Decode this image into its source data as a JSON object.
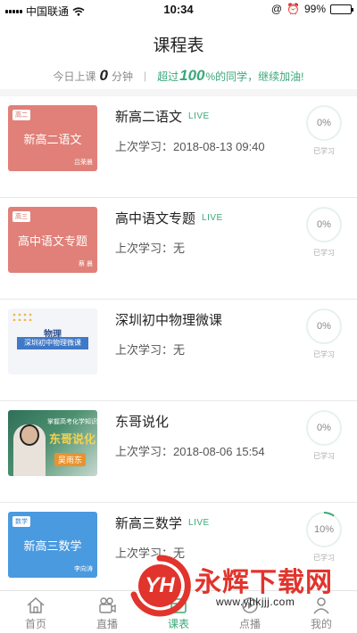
{
  "status_bar": {
    "carrier": "中国联通",
    "time": "10:34",
    "battery_text": "99%",
    "battery_level": 0.99
  },
  "header": {
    "title": "课程表"
  },
  "summary": {
    "prefix": "今日上课",
    "minutes": "0",
    "minutes_unit": "分钟",
    "separator": "|",
    "exceed_prefix": "超过",
    "exceed_percent": "100",
    "exceed_suffix": "%的同学，继续加油!"
  },
  "courses": [
    {
      "title": "新高二语文",
      "live": "LIVE",
      "last_study": "上次学习：2018-08-13  09:40",
      "progress_text": "0%",
      "progress": 0,
      "progress_label": "已学习",
      "thumb_tag": "高二",
      "thumb_title": "新高二语文",
      "thumb_teacher": "吕荣晨"
    },
    {
      "title": "高中语文专题",
      "live": "LIVE",
      "last_study": "上次学习：无",
      "progress_text": "0%",
      "progress": 0,
      "progress_label": "已学习",
      "thumb_tag": "高三",
      "thumb_title": "高中语文专题",
      "thumb_teacher": "蔡  晨"
    },
    {
      "title": "深圳初中物理微课",
      "live": "",
      "last_study": "上次学习：无",
      "progress_text": "0%",
      "progress": 0,
      "progress_label": "已学习",
      "thumb_label": "物理",
      "thumb_bar": "深圳初中物理微课"
    },
    {
      "title": "东哥说化",
      "live": "",
      "last_study": "上次学习：2018-08-06  15:54",
      "progress_text": "0%",
      "progress": 0,
      "progress_label": "已学习",
      "thumb_line": "掌握高考化学知识",
      "thumb_title": "东哥说化",
      "thumb_name": "吴雨东"
    },
    {
      "title": "新高三数学",
      "live": "LIVE",
      "last_study": "上次学习：无",
      "progress_text": "10%",
      "progress": 0.1,
      "progress_label": "已学习",
      "thumb_tag": "数学",
      "thumb_title": "新高三数学",
      "thumb_teacher": "李向涛"
    }
  ],
  "tabs": [
    {
      "label": "首页",
      "icon": "home-icon",
      "active": false
    },
    {
      "label": "直播",
      "icon": "camera-icon",
      "active": false
    },
    {
      "label": "课表",
      "icon": "schedule-icon",
      "active": true
    },
    {
      "label": "点播",
      "icon": "play-icon",
      "active": false
    },
    {
      "label": "我的",
      "icon": "user-icon",
      "active": false
    }
  ],
  "watermark": {
    "logo": "YH",
    "name": "永辉下载网",
    "url": "www.yhkjjj.com"
  },
  "colors": {
    "accent": "#3aa87a",
    "thumb_red": "#e08078",
    "thumb_blue": "#4a9ae0",
    "watermark_red": "#e1342c"
  }
}
